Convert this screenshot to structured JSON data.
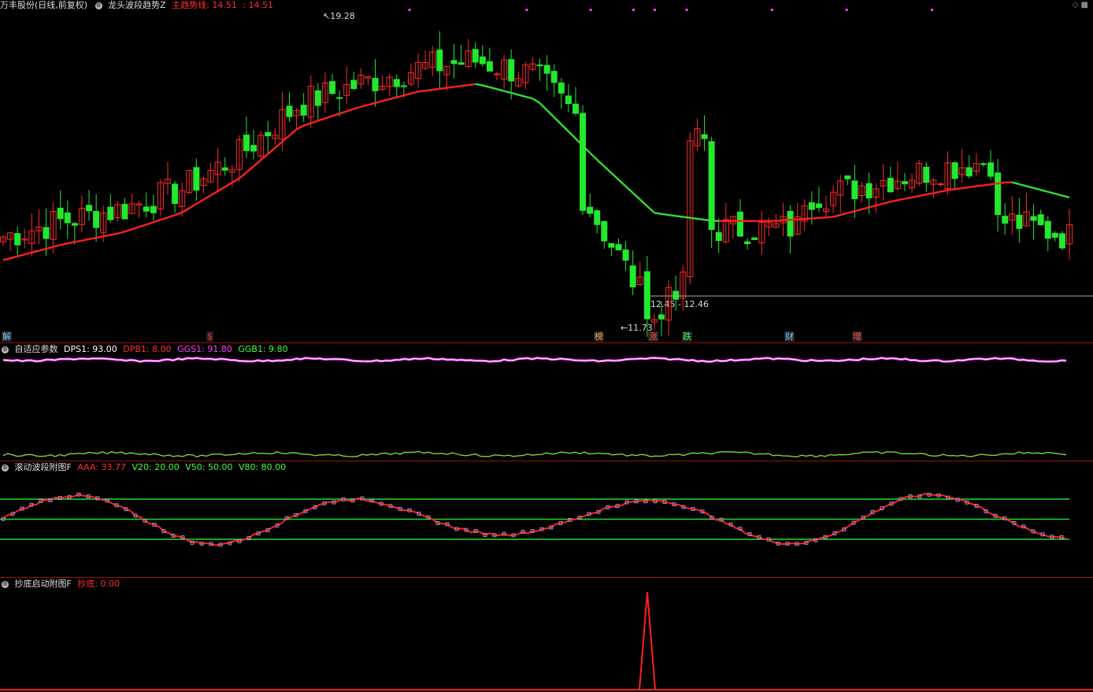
{
  "header": {
    "stock": "万丰股份(日线,前复权)",
    "indicator": "龙头波段趋势Z",
    "main_line_label": "主趋势线: 14.51",
    "main_line_value": ": 14.51",
    "high_label": "19.28",
    "low_label": "11.73",
    "range_label": "12.45 - 12.46"
  },
  "signals": [
    {
      "text": "解",
      "color": "#7ecbff"
    },
    {
      "text": "$",
      "color": "#ff3030"
    },
    {
      "text": "榜",
      "color": "#ffb040"
    },
    {
      "text": "涨",
      "color": "#ff5050"
    },
    {
      "text": "跌",
      "color": "#40ff60"
    },
    {
      "text": "财",
      "color": "#7ecbff"
    },
    {
      "text": "增",
      "color": "#ff5050"
    }
  ],
  "panel2": {
    "title": "自适应参数",
    "dps1": "DPS1: 93.00",
    "dpb1": "DPB1: 8.00",
    "ggs1": "GGS1: 91.80",
    "ggb1": "GGB1: 9.80"
  },
  "panel3": {
    "title": "滚动波段附图F",
    "aaa": "AAA: 33.77",
    "v20": "V20: 20.00",
    "v50": "V50: 50.00",
    "v80": "V80: 80.00"
  },
  "panel4": {
    "title": "抄底启动附图F",
    "value": "抄底: 0.00"
  },
  "colors": {
    "up": "#ff2a2a",
    "down": "#22e82e",
    "trend_up": "#ff2020",
    "trend_down": "#33dd33",
    "magenta": "#ff40ff",
    "panel_sep": "#9a1010"
  },
  "chart_data": [
    {
      "type": "candlestick",
      "ylim": [
        11.4,
        19.6
      ],
      "high": 19.28,
      "low": 11.73,
      "trend_anchor_prices": [
        13.2,
        13.6,
        13.9,
        14.4,
        15.3,
        16.6,
        17.1,
        17.5,
        17.7,
        17.3,
        15.8,
        14.4,
        14.2,
        14.2,
        14.3,
        14.7,
        15.0,
        15.2,
        14.8
      ]
    },
    {
      "type": "line",
      "title": "滚动波段附图F",
      "ylim": [
        0,
        100
      ],
      "reference_lines": [
        20,
        50,
        80
      ],
      "last_value": 33.77
    }
  ]
}
